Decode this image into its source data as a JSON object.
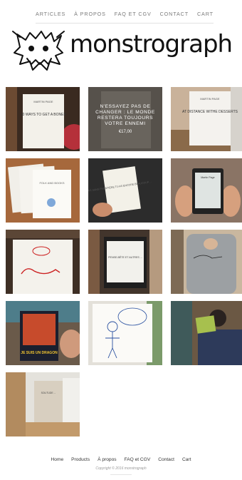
{
  "nav": {
    "items": [
      "ARTICLES",
      "À PROPOS",
      "FAQ ET CGV",
      "CONTACT",
      "CART"
    ]
  },
  "brand": {
    "name": "monstrograph"
  },
  "products": [
    {
      "book_title": "10 WAYS TO GET A BONER",
      "author": "MARTIN PAGE"
    },
    {
      "overlay_title": "N'ESSAYEZ PAS DE CHANGER : LE MONDE RESTERA TOUJOURS VOTRE ENNEMI",
      "overlay_price": "€17,00"
    },
    {
      "book_title": "AT DISTANCE WITHE DESSERTS",
      "author": "MARTIN PAGE"
    },
    {
      "book_title": "FOLK AND BOOKS"
    },
    {
      "book_title": "TAG SANS FRONTIÈRE TU AS ENCORE BEAUCOUP ..."
    },
    {
      "book_title": "Martin Page"
    },
    {
      "book_title": ""
    },
    {
      "book_title": "PENSE-BÊTE ET AUTRES ..."
    },
    {
      "book_title": ""
    },
    {
      "book_title": "JE SUIS UN DRAGON"
    },
    {
      "book_title": ""
    },
    {
      "book_title": ""
    },
    {
      "book_title": "SOLITUDE ..."
    }
  ],
  "footer": {
    "links": [
      "Home",
      "Products",
      "À propos",
      "FAQ et CGV",
      "Contact",
      "Cart"
    ],
    "copyright": "Copyright © 2016 monstrograph"
  },
  "colors": {
    "text": "#333333",
    "muted": "#7a7a7a",
    "background": "#ffffff"
  }
}
